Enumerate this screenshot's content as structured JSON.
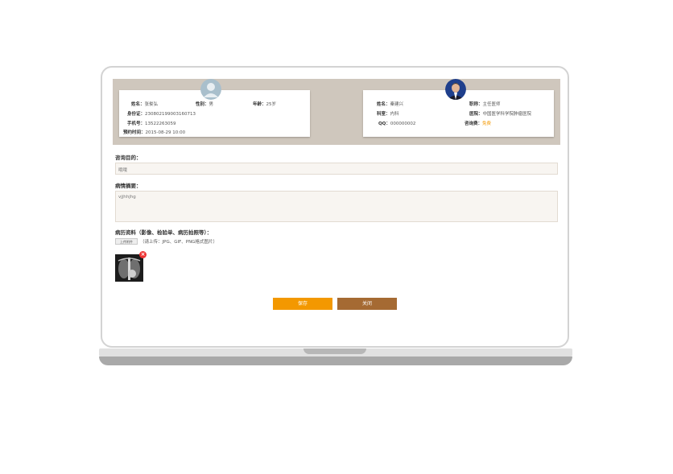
{
  "patient": {
    "name_label": "姓名：",
    "name": "张俊弘",
    "gender_label": "性别：",
    "gender": "男",
    "age_label": "年龄：",
    "age": "25岁",
    "id_label": "身份证：",
    "id": "230802199003160713",
    "phone_label": "手机号：",
    "phone": "13522263059",
    "appt_label": "预约时间：",
    "appt": "2015-08-29 10:00"
  },
  "doctor": {
    "name_label": "姓名：",
    "name": "秦建兴",
    "title_label": "职称：",
    "title": "主任医师",
    "dept_label": "科室：",
    "dept": "内科",
    "hospital_label": "医院：",
    "hospital": "中国医学科学院肿瘤医院",
    "qq_label": "QQ：",
    "qq": "000000002",
    "fee_label": "咨询费：",
    "fee": "免费"
  },
  "form": {
    "purpose_label": "咨询目的：",
    "purpose_value": "哦哦",
    "summary_label": "病情摘要：",
    "summary_value": "vjjhhjhg",
    "records_label": "病历资料（影像、检验单、病历拍照等）：",
    "upload_button": "上传附件",
    "upload_hint": "（请上传：JPG、GIF、PNG格式图片）"
  },
  "actions": {
    "save": "保存",
    "close": "关闭"
  },
  "colors": {
    "save": "#f39800",
    "close": "#a56a33",
    "band": "#cfc7bd"
  }
}
